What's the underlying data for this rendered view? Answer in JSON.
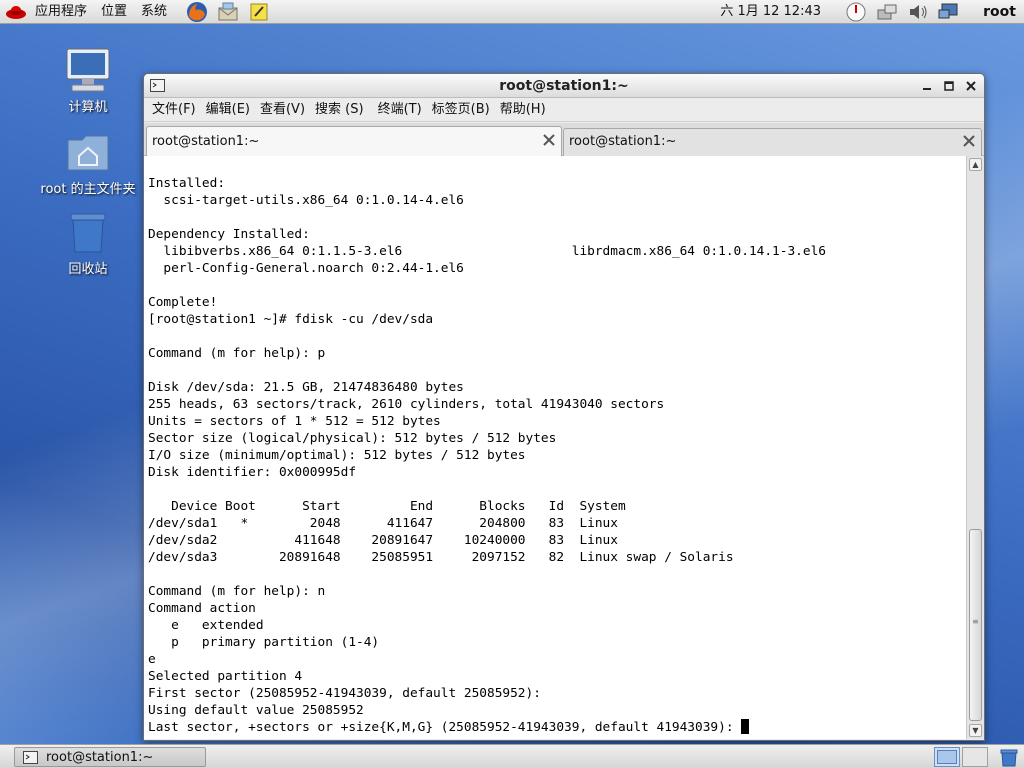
{
  "top_panel": {
    "menu": [
      "应用程序",
      "位置",
      "系统"
    ],
    "clock": "六 1月 12 12:43",
    "user": "root"
  },
  "desktop": {
    "icons": [
      {
        "label": "计算机",
        "icon": "computer-icon"
      },
      {
        "label": "root 的主文件夹",
        "icon": "home-folder-icon"
      },
      {
        "label": "回收站",
        "icon": "trash-icon"
      }
    ]
  },
  "window": {
    "title": "root@station1:~",
    "menus": [
      "文件(F)",
      "编辑(E)",
      "查看(V)",
      "搜索 (S)",
      "终端(T)",
      "标签页(B)",
      "帮助(H)"
    ],
    "tabs": [
      {
        "label": "root@station1:~",
        "active": true
      },
      {
        "label": "root@station1:~",
        "active": false
      }
    ]
  },
  "terminal": {
    "lines": [
      "Installed:",
      "  scsi-target-utils.x86_64 0:1.0.14-4.el6",
      "",
      "Dependency Installed:",
      "  libibverbs.x86_64 0:1.1.5-3.el6                      librdmacm.x86_64 0:1.0.14.1-3.el6",
      "  perl-Config-General.noarch 0:2.44-1.el6",
      "",
      "Complete!",
      "[root@station1 ~]# fdisk -cu /dev/sda",
      "",
      "Command (m for help): p",
      "",
      "Disk /dev/sda: 21.5 GB, 21474836480 bytes",
      "255 heads, 63 sectors/track, 2610 cylinders, total 41943040 sectors",
      "Units = sectors of 1 * 512 = 512 bytes",
      "Sector size (logical/physical): 512 bytes / 512 bytes",
      "I/O size (minimum/optimal): 512 bytes / 512 bytes",
      "Disk identifier: 0x000995df",
      "",
      "   Device Boot      Start         End      Blocks   Id  System",
      "/dev/sda1   *        2048      411647      204800   83  Linux",
      "/dev/sda2          411648    20891647    10240000   83  Linux",
      "/dev/sda3        20891648    25085951     2097152   82  Linux swap / Solaris",
      "",
      "Command (m for help): n",
      "Command action",
      "   e   extended",
      "   p   primary partition (1-4)",
      "e",
      "Selected partition 4",
      "First sector (25085952-41943039, default 25085952):",
      "Using default value 25085952"
    ],
    "prompt_line": "Last sector, +sectors or +size{K,M,G} (25085952-41943039, default 41943039): "
  },
  "taskbar": {
    "item_label": "root@station1:~"
  },
  "colors": {
    "desktop_blue": "#3d6fc4",
    "terminal_bg": "#ffffff",
    "terminal_fg": "#000000"
  }
}
